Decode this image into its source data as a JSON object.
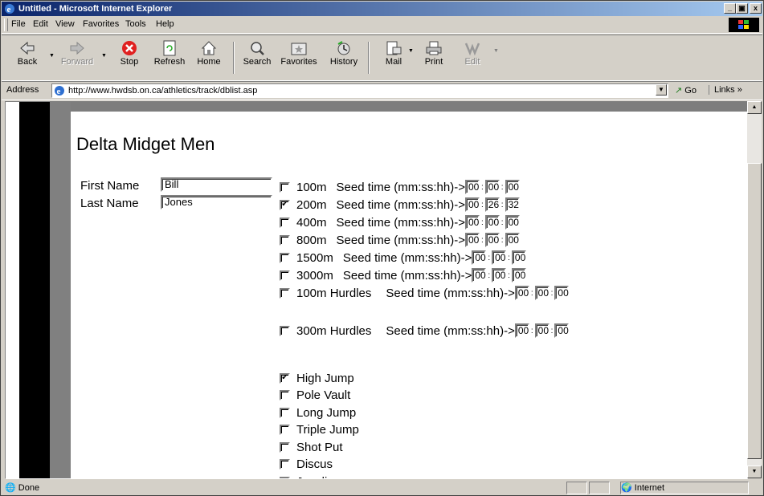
{
  "window": {
    "title": "Untitled - Microsoft Internet Explorer",
    "minimize": "_",
    "maximize": "▣",
    "close": "x"
  },
  "menu": [
    "File",
    "Edit",
    "View",
    "Favorites",
    "Tools",
    "Help"
  ],
  "toolbar": {
    "back": "Back",
    "forward": "Forward",
    "stop": "Stop",
    "refresh": "Refresh",
    "home": "Home",
    "search": "Search",
    "favorites": "Favorites",
    "history": "History",
    "mail": "Mail",
    "print": "Print",
    "edit": "Edit"
  },
  "address": {
    "label": "Address",
    "url": "http://www.hwdsb.on.ca/athletics/track/dblist.asp",
    "go": "Go",
    "links": "Links »"
  },
  "page": {
    "title": "Delta Midget Men",
    "first_name_label": "First Name",
    "first_name_value": "Bill",
    "last_name_label": "Last Name",
    "last_name_value": "Jones",
    "seed_label": "Seed time (mm:ss:hh)->",
    "track_events": [
      {
        "name": "100m",
        "checked": false,
        "mm": "00",
        "ss": "00",
        "hh": "00"
      },
      {
        "name": "200m",
        "checked": true,
        "mm": "00",
        "ss": "26",
        "hh": "32"
      },
      {
        "name": "400m",
        "checked": false,
        "mm": "00",
        "ss": "00",
        "hh": "00"
      },
      {
        "name": "800m",
        "checked": false,
        "mm": "00",
        "ss": "00",
        "hh": "00"
      },
      {
        "name": "1500m",
        "checked": false,
        "mm": "00",
        "ss": "00",
        "hh": "00"
      },
      {
        "name": "3000m",
        "checked": false,
        "mm": "00",
        "ss": "00",
        "hh": "00"
      },
      {
        "name": "100m Hurdles",
        "checked": false,
        "mm": "00",
        "ss": "00",
        "hh": "00"
      },
      {
        "name": "300m Hurdles",
        "checked": false,
        "mm": "00",
        "ss": "00",
        "hh": "00"
      }
    ],
    "field_events": [
      {
        "name": "High Jump",
        "checked": true
      },
      {
        "name": "Pole Vault",
        "checked": false
      },
      {
        "name": "Long Jump",
        "checked": false
      },
      {
        "name": "Triple Jump",
        "checked": false
      },
      {
        "name": "Shot Put",
        "checked": false
      },
      {
        "name": "Discus",
        "checked": false
      },
      {
        "name": "Javelin",
        "checked": false
      }
    ]
  },
  "status": {
    "text": "Done",
    "zone": "Internet"
  }
}
